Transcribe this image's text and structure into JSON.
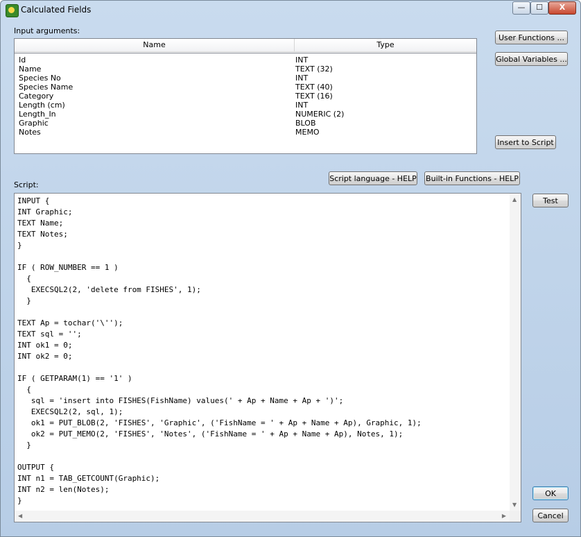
{
  "window": {
    "title": "Calculated Fields",
    "controls": {
      "minimize": "—",
      "maximize": "☐",
      "close": "X"
    }
  },
  "input_args": {
    "label": "Input arguments:",
    "columns": [
      "Name",
      "Type"
    ],
    "rows": [
      {
        "name": "Id",
        "type": "INT"
      },
      {
        "name": "Name",
        "type": "TEXT (32)"
      },
      {
        "name": "Species No",
        "type": "INT"
      },
      {
        "name": "Species Name",
        "type": "TEXT (40)"
      },
      {
        "name": "Category",
        "type": "TEXT (16)"
      },
      {
        "name": "Length (cm)",
        "type": "INT"
      },
      {
        "name": "Length_In",
        "type": "NUMERIC (2)"
      },
      {
        "name": "Graphic",
        "type": "BLOB"
      },
      {
        "name": "Notes",
        "type": "MEMO"
      }
    ]
  },
  "buttons": {
    "user_functions": "User Functions ...",
    "global_variables": "Global Variables ...",
    "insert_to_script": "Insert to Script",
    "script_help": "Script language - HELP",
    "builtin_help": "Built-in Functions - HELP",
    "test": "Test",
    "ok": "OK",
    "cancel": "Cancel"
  },
  "script": {
    "label": "Script:",
    "code": "INPUT {\nINT Graphic;\nTEXT Name;\nTEXT Notes;\n}\n\nIF ( ROW_NUMBER == 1 )\n  {\n   EXECSQL2(2, 'delete from FISHES', 1);\n  }\n\nTEXT Ap = tochar('\\'');\nTEXT sql = '';\nINT ok1 = 0;\nINT ok2 = 0;\n\nIF ( GETPARAM(1) == '1' )\n  {\n   sql = 'insert into FISHES(FishName) values(' + Ap + Name + Ap + ')';\n   EXECSQL2(2, sql, 1);\n   ok1 = PUT_BLOB(2, 'FISHES', 'Graphic', ('FishName = ' + Ap + Name + Ap), Graphic, 1);\n   ok2 = PUT_MEMO(2, 'FISHES', 'Notes', ('FishName = ' + Ap + Name + Ap), Notes, 1);\n  }\n\nOUTPUT {\nINT n1 = TAB_GETCOUNT(Graphic);\nINT n2 = len(Notes);\n}"
  }
}
